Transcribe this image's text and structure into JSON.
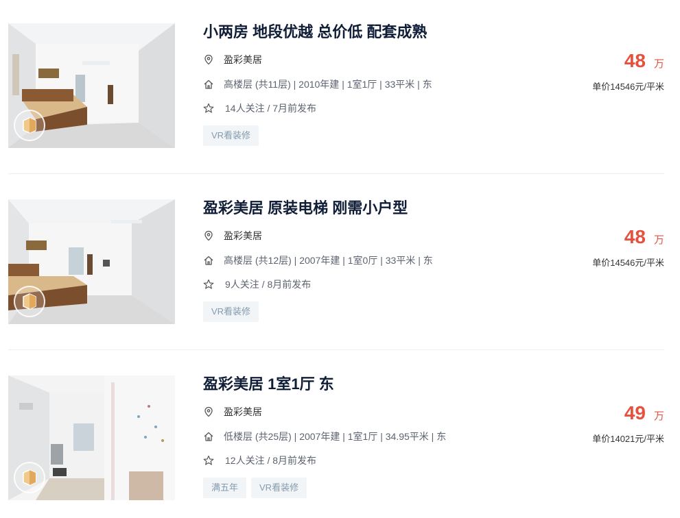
{
  "listings": [
    {
      "title": "小两房 地段优越 总价低 配套成熟",
      "position": "盈彩美居",
      "house_info": "高楼层 (共11层) | 2010年建 | 1室1厅 | 33平米 | 东",
      "follow_info": "14人关注 / 7月前发布",
      "tags": [
        "VR看装修"
      ],
      "total_price": "48",
      "total_unit": "万",
      "unit_price": "单价14546元/平米"
    },
    {
      "title": "盈彩美居 原装电梯 刚需小户型",
      "position": "盈彩美居",
      "house_info": "高楼层 (共12层) | 2007年建 | 1室0厅 | 33平米 | 东",
      "follow_info": "9人关注 / 8月前发布",
      "tags": [
        "VR看装修"
      ],
      "total_price": "48",
      "total_unit": "万",
      "unit_price": "单价14546元/平米"
    },
    {
      "title": "盈彩美居 1室1厅 东",
      "position": "盈彩美居",
      "house_info": "低楼层 (共25层) | 2007年建 | 1室1厅 | 34.95平米 | 东",
      "follow_info": "12人关注 / 8月前发布",
      "tags": [
        "满五年",
        "VR看装修"
      ],
      "total_price": "49",
      "total_unit": "万",
      "unit_price": "单价14021元/平米"
    }
  ],
  "icons": {
    "position": "location-pin-icon",
    "house": "house-icon",
    "follow": "star-icon",
    "vr": "vr-panorama-icon"
  },
  "colors": {
    "title": "#101d37",
    "price": "#e5513e",
    "tag_bg": "#f2f5f7",
    "tag_text": "#849aae"
  }
}
